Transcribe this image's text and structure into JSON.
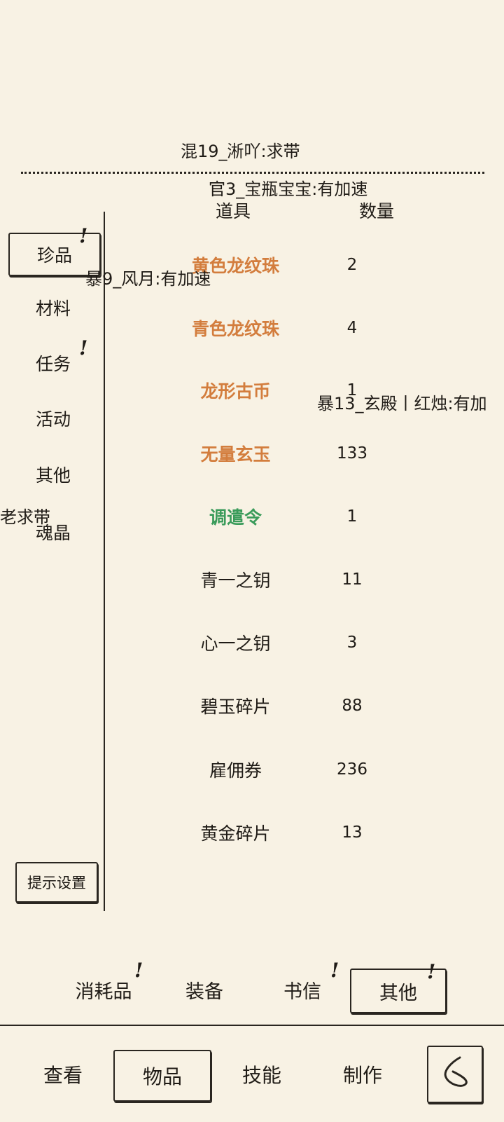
{
  "danmaku": [
    "混19_淅吖:求带",
    "官3_宝瓶宝宝:有加速",
    "暴9_风月:有加速",
    "暴13_玄殿丨红烛:有加",
    "老求带"
  ],
  "table": {
    "col_item": "道具",
    "col_count": "数量",
    "rows": [
      {
        "name": "黄色龙纹珠",
        "qty": "2",
        "color": "#d37d3d"
      },
      {
        "name": "青色龙纹珠",
        "qty": "4",
        "color": "#d37d3d"
      },
      {
        "name": "龙形古币",
        "qty": "1",
        "color": "#d37d3d"
      },
      {
        "name": "无量玄玉",
        "qty": "133",
        "color": "#d37d3d"
      },
      {
        "name": "调遣令",
        "qty": "1",
        "color": "#3a9b5a"
      },
      {
        "name": "青一之钥",
        "qty": "11"
      },
      {
        "name": "心一之钥",
        "qty": "3"
      },
      {
        "name": "碧玉碎片",
        "qty": "88"
      },
      {
        "name": "雇佣券",
        "qty": "236"
      },
      {
        "name": "黄金碎片",
        "qty": "13"
      }
    ]
  },
  "sidebar": {
    "items": [
      {
        "label": "珍品",
        "active": true,
        "alert": true
      },
      {
        "label": "材料"
      },
      {
        "label": "任务",
        "alert": true
      },
      {
        "label": "活动"
      },
      {
        "label": "其他"
      },
      {
        "label": "魂晶"
      }
    ],
    "tips_button": "提示设置"
  },
  "alert_mark": "!",
  "subtabs": [
    "消耗品",
    "装备",
    "书信",
    "其他"
  ],
  "nav": [
    "查看",
    "物品",
    "技能",
    "制作"
  ],
  "icons": {
    "back": "back-arrow-icon"
  },
  "colors": {
    "background": "#f8f2e4",
    "rare_orange": "#d37d3d",
    "task_green": "#3a9b5a",
    "ink": "#2a2620"
  }
}
